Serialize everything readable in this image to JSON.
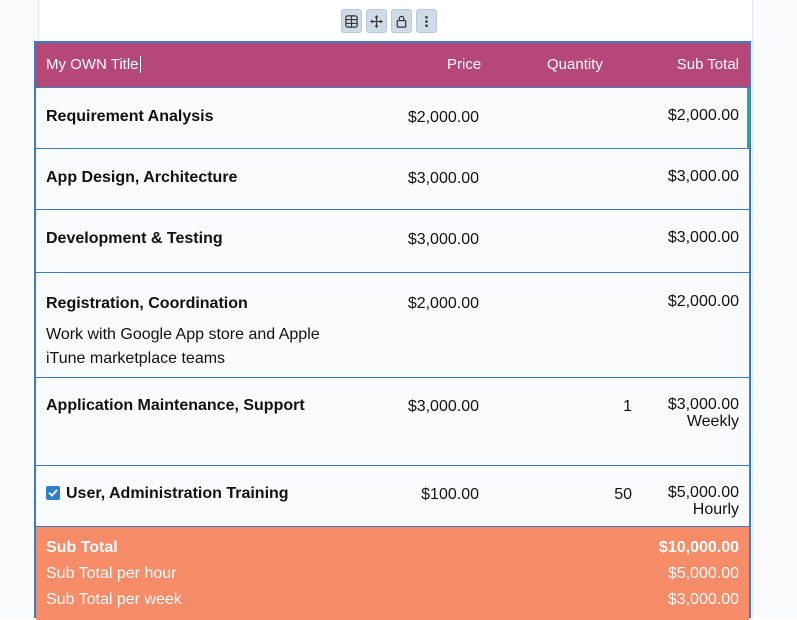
{
  "toolbar": {
    "buttons": [
      "table-settings-icon",
      "move-icon",
      "lock-icon",
      "more-vertical-icon"
    ]
  },
  "table": {
    "header": {
      "title": "My OWN Title",
      "price": "Price",
      "quantity": "Quantity",
      "subtotal": "Sub Total"
    },
    "rows": [
      {
        "name": "Requirement Analysis",
        "description": "",
        "price": "$2,000.00",
        "quantity": "",
        "subtotal": "$2,000.00",
        "unit": ""
      },
      {
        "name": "App Design, Architecture",
        "description": "",
        "price": "$3,000.00",
        "quantity": "",
        "subtotal": "$3,000.00",
        "unit": ""
      },
      {
        "name": "Development & Testing",
        "description": "",
        "price": "$3,000.00",
        "quantity": "",
        "subtotal": "$3,000.00",
        "unit": ""
      },
      {
        "name": "Registration, Coordination",
        "description": "Work with Google App store and Apple iTune marketplace teams",
        "price": "$2,000.00",
        "quantity": "",
        "subtotal": "$2,000.00",
        "unit": ""
      },
      {
        "name": "Application Maintenance, Support",
        "description": "",
        "price": "$3,000.00",
        "quantity": "1",
        "subtotal": "$3,000.00",
        "unit": "Weekly"
      },
      {
        "name": "User, Administration Training",
        "description": "",
        "price": "$100.00",
        "quantity": "50",
        "subtotal": "$5,000.00",
        "unit": "Hourly",
        "checked": true
      }
    ],
    "totals": [
      {
        "label": "Sub Total",
        "value": "$10,000.00"
      },
      {
        "label": "Sub Total per hour",
        "value": "$5,000.00"
      },
      {
        "label": "Sub Total per week",
        "value": "$3,000.00"
      }
    ]
  },
  "colors": {
    "header_bg": "#b54878",
    "totals_bg": "#f78c69",
    "border": "#3a7dc0",
    "checkbox": "#2f7fc9",
    "active_edge": "#26a6a0"
  }
}
